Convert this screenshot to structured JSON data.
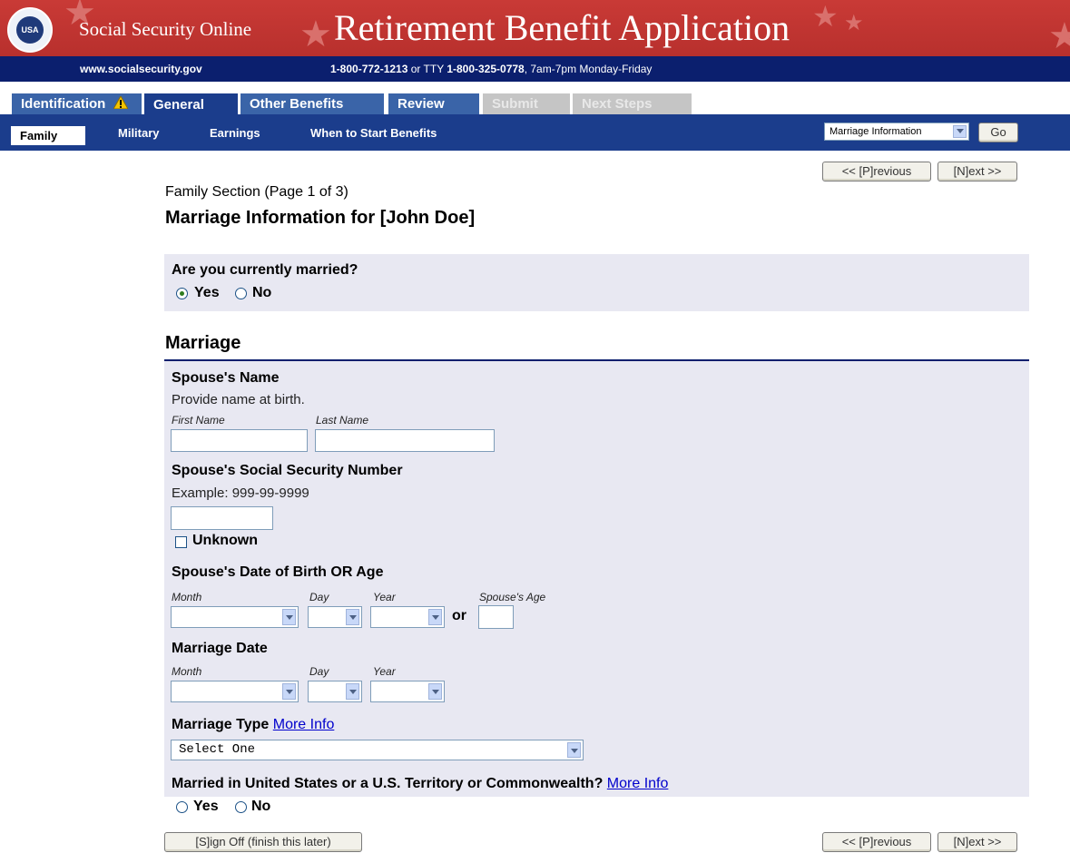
{
  "header": {
    "brand": "Social Security Online",
    "app_title": "Retirement Benefit Application",
    "url": "www.socialsecurity.gov",
    "phone_main": "1-800-772-1213",
    "phone_or": " or TTY ",
    "phone_tty": "1-800-325-0778",
    "hours": ", 7am-7pm Monday-Friday",
    "seal_text": "USA",
    "brand_color": "#c93a36",
    "nav_color": "#0b1f6e"
  },
  "tabs": [
    {
      "label": "Identification",
      "state": "warning",
      "icon": "warning-icon"
    },
    {
      "label": "General",
      "state": "active"
    },
    {
      "label": "Other Benefits",
      "state": "enabled"
    },
    {
      "label": "Review",
      "state": "enabled"
    },
    {
      "label": "Submit",
      "state": "disabled"
    },
    {
      "label": "Next Steps",
      "state": "disabled"
    }
  ],
  "subnav": {
    "items": [
      "Family",
      "Military",
      "Earnings",
      "When to Start Benefits"
    ],
    "active": "Family",
    "jump_select": "Marriage Information",
    "go_label": "Go"
  },
  "pager": {
    "previous": "<< [P]revious",
    "next": "[N]ext >>"
  },
  "page": {
    "section": "Family Section (Page 1 of 3)",
    "title": "Marriage Information for [John Doe]"
  },
  "married_question": {
    "label": "Are you currently married?",
    "yes": "Yes",
    "no": "No",
    "selected": "Yes"
  },
  "marriage": {
    "heading": "Marriage",
    "spouse_name": {
      "label": "Spouse's Name",
      "hint": "Provide name at birth.",
      "first_label": "First Name",
      "last_label": "Last Name",
      "first_value": "",
      "last_value": ""
    },
    "spouse_ssn": {
      "label": "Spouse's Social Security Number",
      "hint": "Example: 999-99-9999",
      "value": "",
      "unknown_label": "Unknown"
    },
    "spouse_dob": {
      "label": "Spouse's Date of Birth OR Age",
      "month_label": "Month",
      "day_label": "Day",
      "year_label": "Year",
      "or_label": "or",
      "age_label": "Spouse's Age"
    },
    "marriage_date": {
      "label": "Marriage Date",
      "month_label": "Month",
      "day_label": "Day",
      "year_label": "Year"
    },
    "marriage_type": {
      "label": "Marriage Type",
      "more_info": "More Info",
      "selected": "Select One"
    },
    "married_in_us": {
      "label": "Married in United States or a U.S. Territory or Commonwealth?",
      "more_info": "More Info",
      "yes": "Yes",
      "no": "No"
    }
  },
  "footer": {
    "sign_off": "[S]ign Off (finish this later)"
  }
}
